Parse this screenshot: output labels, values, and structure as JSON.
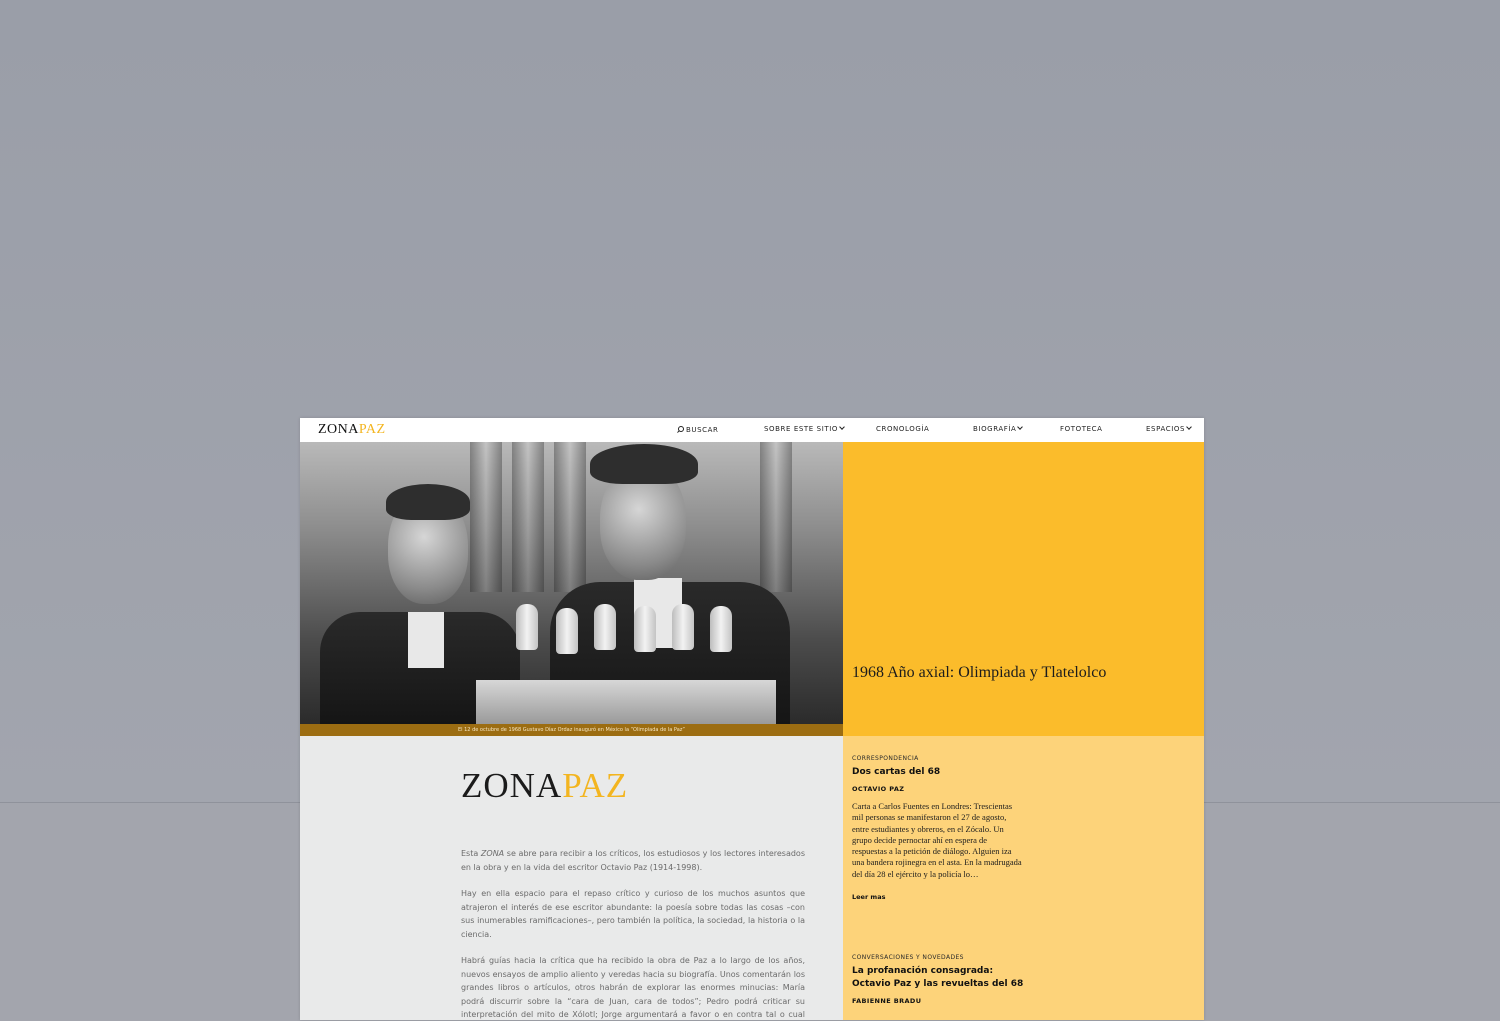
{
  "nav": {
    "logo": {
      "part1": "ZONA",
      "part2": "PAZ"
    },
    "search": "BUSCAR",
    "items": [
      "SOBRE ESTE SITIO",
      "CRONOLOGÍA",
      "BIOGRAFÍA",
      "FOTOTECA",
      "ESPACIOS"
    ]
  },
  "hero": {
    "caption": "El 12 de octubre de 1968 Gustavo Díaz Ordaz inauguró en México la “Olimpiada de la Paz”",
    "feature_title": "1968 Año axial: Olimpiada y Tlatelolco"
  },
  "intro": {
    "logo": {
      "part1": "ZONA",
      "part2": "PAZ"
    },
    "p1_before": "Esta ",
    "p1_italic": "ZONA",
    "p1_after": " se abre para recibir a los críticos, los estudiosos y los lectores interesados en la obra y en la vida del escritor Octavio Paz (1914-1998).",
    "p2": "Hay en ella espacio para el repaso crítico y curioso de los muchos asuntos que atrajeron el interés de ese escritor abundante: la poesía sobre todas las cosas –con sus inumerables ramificaciones–, pero también la política, la sociedad, la historia o la ciencia.",
    "p3": "Habrá guías hacia la crítica que ha recibido la obra de Paz a lo largo de los años, nuevos ensayos de amplio aliento y veredas hacia su biografía. Unos comentarán los grandes libros o artículos, otros habrán de explorar las enormes minucias: María podrá discurrir sobre la “cara de Juan, cara de todos”; Pedro podrá criticar su interpretación del mito de Xólotl; Jorge argumentará a favor o en contra tal o cual análisis político y Estela podrá investigar su interés en las ciencias humanas, o en las físicas y naturales."
  },
  "articles": [
    {
      "category": "CORRESPONDENCIA",
      "title": "Dos cartas del 68",
      "author": "OCTAVIO PAZ",
      "excerpt": "Carta a Carlos Fuentes en Londres: Trescientas mil personas se manifestaron el 27 de agosto, entre estudiantes y obreros, en el Zócalo. Un grupo decide pernoctar ahí en espera de respuestas a la petición de diálogo. Alguien iza una bandera rojinegra en el asta. En la madrugada del día 28 el ejército y la policía lo…",
      "more": "Leer mas"
    },
    {
      "category": "CONVERSACIONES Y NOVEDADES",
      "title": "La profanación consagrada: Octavio Paz y las revueltas del 68",
      "author": "FABIENNE BRADU"
    }
  ],
  "colors": {
    "accent": "#fbbc2b",
    "accent_light": "#fdd37a",
    "caption_bar": "#9c6d12",
    "intro_bg": "#e9eaea",
    "backdrop": "#9ea1aa"
  }
}
